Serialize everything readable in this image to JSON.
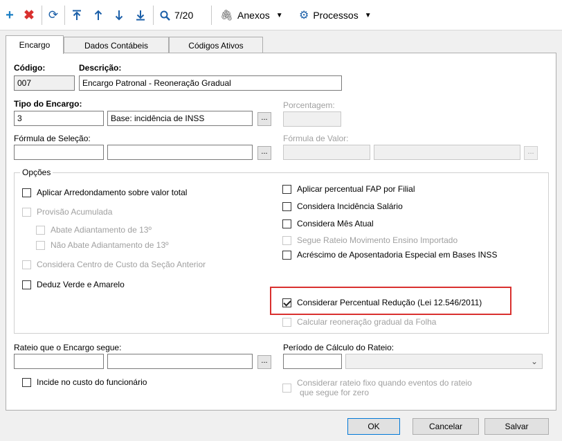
{
  "toolbar": {
    "counter": "7/20",
    "anexos_label": "Anexos",
    "processos_label": "Processos"
  },
  "tabs": [
    {
      "label": "Encargo"
    },
    {
      "label": "Dados Contábeis"
    },
    {
      "label": "Códigos Ativos"
    }
  ],
  "form": {
    "codigo_label": "Código:",
    "codigo_value": "007",
    "descricao_label": "Descrição:",
    "descricao_value": "Encargo Patronal - Reoneração Gradual",
    "tipo_label": "Tipo do Encargo:",
    "tipo_code": "3",
    "tipo_desc": "Base: incidência de INSS",
    "porcentagem_label": "Porcentagem:",
    "formula_selecao_label": "Fórmula de Seleção:",
    "formula_valor_label": "Fórmula de Valor:",
    "dots": "..."
  },
  "opcoes": {
    "title": "Opções",
    "left": [
      {
        "label": "Aplicar Arredondamento sobre valor total",
        "checked": false,
        "disabled": false
      },
      {
        "label": "Provisão Acumulada",
        "checked": false,
        "disabled": true
      },
      {
        "label": "Abate Adiantamento de 13º",
        "checked": false,
        "disabled": true
      },
      {
        "label": "Não Abate Adiantamento de 13º",
        "checked": false,
        "disabled": true
      },
      {
        "label": "Considera Centro de Custo da Seção Anterior",
        "checked": false,
        "disabled": true
      },
      {
        "label": "Deduz Verde e Amarelo",
        "checked": false,
        "disabled": false
      }
    ],
    "right": [
      {
        "label": "Aplicar percentual FAP por Filial",
        "checked": false,
        "disabled": false
      },
      {
        "label": "Considera Incidência Salário",
        "checked": false,
        "disabled": false
      },
      {
        "label": "Considera Mês Atual",
        "checked": false,
        "disabled": false
      },
      {
        "label": "Segue Rateio Movimento Ensino Importado",
        "checked": false,
        "disabled": true
      },
      {
        "label": "Acréscimo de Aposentadoria Especial em Bases INSS",
        "checked": false,
        "disabled": false
      },
      {
        "label": "Considerar Percentual Redução (Lei 12.546/2011)",
        "checked": true,
        "disabled": false
      },
      {
        "label": "Calcular reoneração gradual da Folha",
        "checked": false,
        "disabled": true
      }
    ]
  },
  "rateio": {
    "label": "Rateio que o Encargo segue:",
    "periodo_label": "Período de Cálculo do Rateio:",
    "incide_label": "Incide no custo do funcionário",
    "fixo_label_line1": "Considerar rateio fixo quando eventos do rateio",
    "fixo_label_line2": "que segue for zero"
  },
  "buttons": {
    "ok": "OK",
    "cancelar": "Cancelar",
    "salvar": "Salvar"
  },
  "colors": {
    "add": "#1b7fc4",
    "delete": "#d9302e",
    "highlight": "#d9302e",
    "toolbar_blue": "#1b5fa8"
  }
}
